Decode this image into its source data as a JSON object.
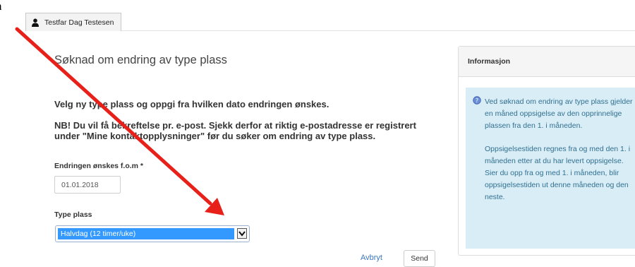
{
  "cropped_fragment": "n",
  "user_tab": {
    "name": "Testfar Dag Testesen",
    "icon": "user-icon"
  },
  "page": {
    "title": "Søknad om endring av type plass",
    "intro": "Velg ny type plass og oppgi fra hvilken dato endringen ønskes.",
    "note": "NB! Du vil få bekreftelse pr. e-post. Sjekk derfor at riktig e-postadresse er registrert under \"Mine kontaktopplysninger\" før du søker om endring av type plass."
  },
  "form": {
    "date_label": "Endringen ønskes f.o.m *",
    "date_value": "01.01.2018",
    "type_label": "Type plass",
    "type_selected": "Halvdag (12 timer/uke)"
  },
  "actions": {
    "cancel": "Avbryt",
    "send": "Send"
  },
  "info": {
    "title": "Informasjon",
    "icon": "info-icon",
    "paragraph1": "Ved søknad om endring av type plass gjelder en måned oppsigelse av den opprinnelige plassen fra den 1. i måneden.",
    "paragraph2": "Oppsigelsestiden regnes fra og med den 1. i måneden etter at du har levert oppsigelse. Sier du opp fra og med 1. i måneden, blir oppsigelsestiden ut denne måneden og den neste."
  },
  "colors": {
    "annotation_arrow": "#e8201a",
    "link": "#3b78bd",
    "selection": "#3399ff",
    "info_bg": "#d9edf7"
  }
}
